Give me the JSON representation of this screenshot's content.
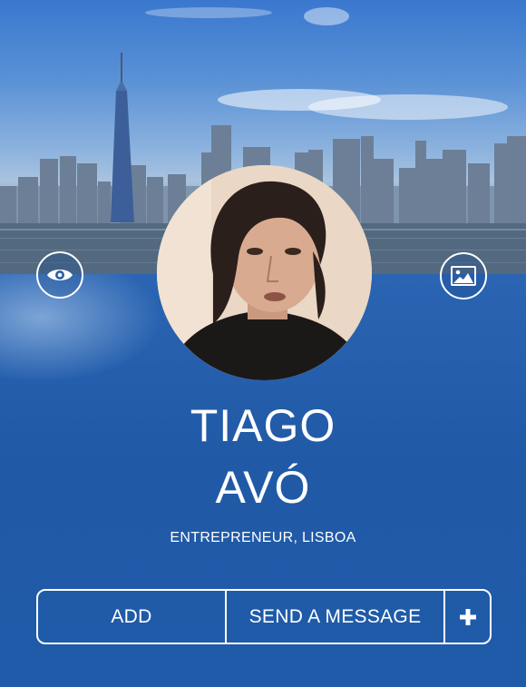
{
  "cover": {
    "icon": "city-skyline-photo"
  },
  "left_button": {
    "icon": "eye-icon"
  },
  "right_button": {
    "icon": "image-icon"
  },
  "profile": {
    "avatar": "profile-photo",
    "first_name": "TIAGO",
    "last_name": "AVÓ",
    "subtitle": "ENTREPRENEUR, LISBOA"
  },
  "actions": {
    "add_label": "ADD",
    "message_label": "SEND A MESSAGE",
    "more_icon": "plus-icon"
  },
  "colors": {
    "background": "#1f5aa6",
    "accent_bar": "#1c3f8f",
    "text": "#ffffff"
  }
}
